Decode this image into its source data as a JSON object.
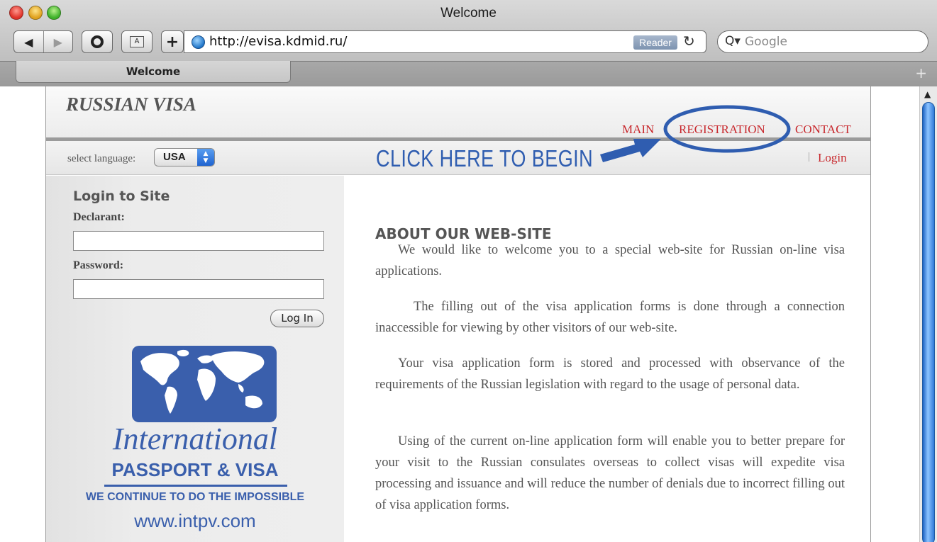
{
  "window": {
    "title": "Welcome"
  },
  "toolbar": {
    "back_icon": "◀",
    "forward_icon": "▶",
    "add_label": "+",
    "translate_label": "A",
    "url": "http://evisa.kdmid.ru/",
    "reader_label": "Reader",
    "reload_icon": "↻",
    "search_placeholder": "Google",
    "search_icon": "Q▾"
  },
  "tabs": [
    {
      "label": "Welcome",
      "active": true
    }
  ],
  "tab_add_icon": "+",
  "site": {
    "logo": "RUSSIAN VISA",
    "nav": {
      "main": "MAIN",
      "registration": "REGISTRATION",
      "contact": "CONTACT"
    },
    "language": {
      "label": "select language:",
      "value": "USA"
    },
    "login_separator": "|",
    "login_link": "Login"
  },
  "login_form": {
    "title": "Login to Site",
    "declarant_label": "Declarant:",
    "declarant_value": "",
    "password_label": "Password:",
    "password_value": "",
    "button_label": "Log In"
  },
  "advertisement": {
    "script_text": "International",
    "brand": "PASSPORT & VISA",
    "slogan": "WE CONTINUE TO DO THE IMPOSSIBLE",
    "url": "www.intpv.com"
  },
  "content": {
    "title": "ABOUT OUR WEB-SITE",
    "paragraphs": [
      "We would like to welcome you to a special web-site for Russian on-line visa applications.",
      "The filling out of the visa application forms is done through a connection inaccessible for viewing by other visitors of our web-site.",
      "Your visa application form is stored and processed with observance of the requirements of the Russian legislation with regard to the usage of personal data.",
      "Using of the current on-line application form will enable you to better prepare for your visit to the Russian consulates overseas to collect visas will expedite visa processing and issuance and will reduce the number of denials due to incorrect filling out of visa application forms."
    ]
  },
  "annotation": {
    "text": "CLICK HERE TO BEGIN",
    "color": "#2f5db0"
  },
  "colors": {
    "nav_link": "#c8282d",
    "brand_blue": "#3a5fac"
  }
}
